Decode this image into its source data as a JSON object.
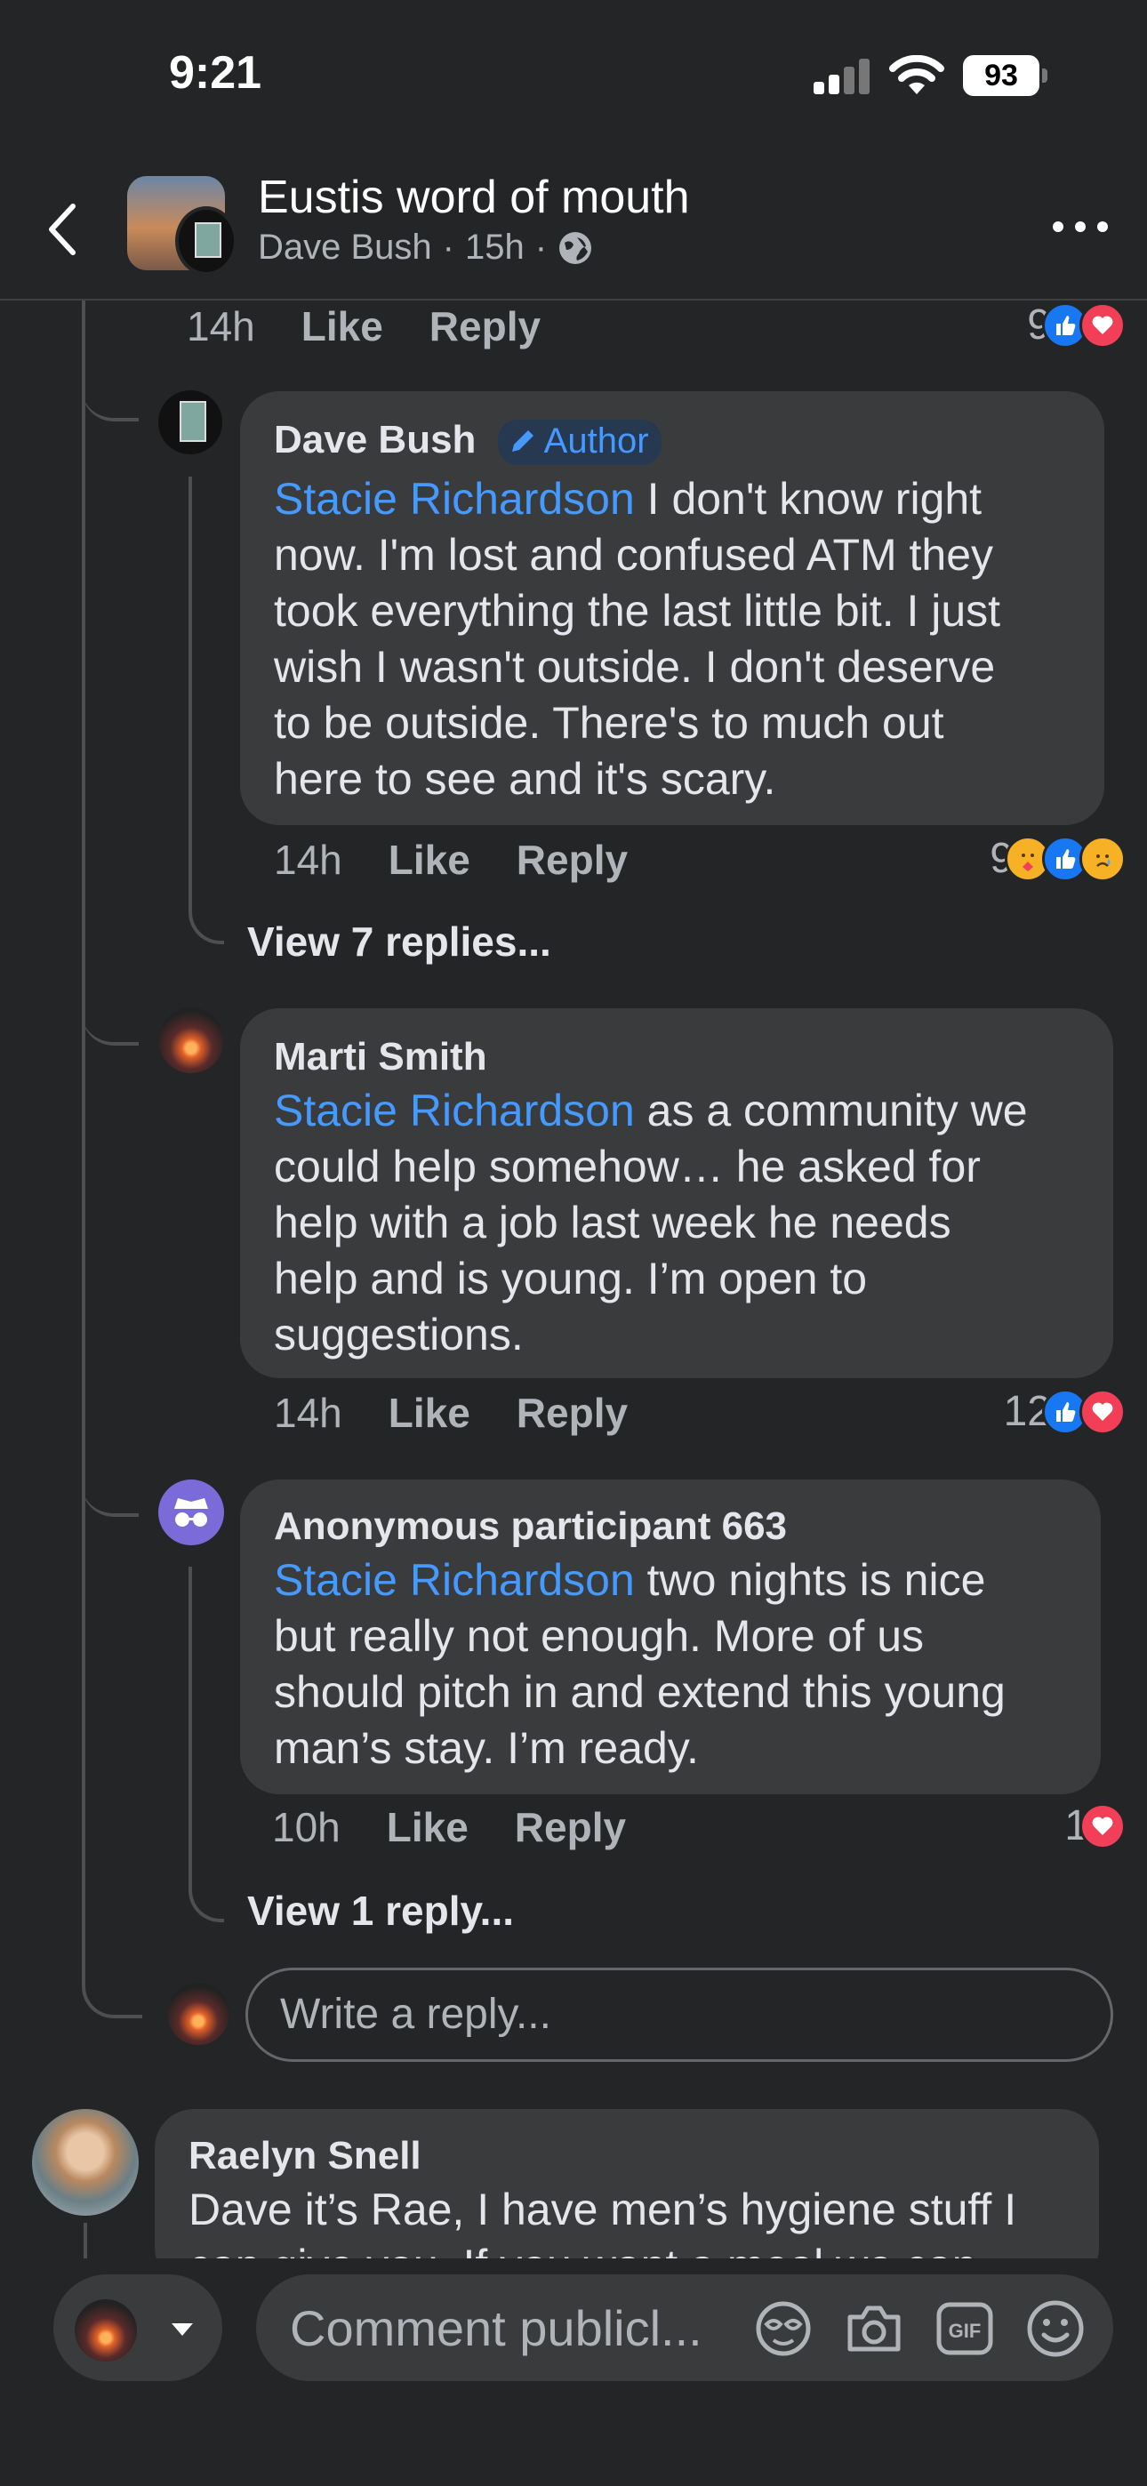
{
  "status_bar": {
    "time": "9:21",
    "battery": "93"
  },
  "header": {
    "title": "Eustis word of mouth",
    "author": "Dave Bush",
    "time": "15h"
  },
  "top_meta": {
    "time": "14h",
    "like": "Like",
    "reply": "Reply",
    "reaction_count": "9"
  },
  "comments": [
    {
      "name": "Dave Bush",
      "badge": "Author",
      "mention": "Stacie Richardson",
      "line1_rest": " I don't know right",
      "lines": [
        "now. I'm lost and confused ATM they",
        "took everything the last little bit. I just",
        "wish I wasn't outside. I don't deserve",
        "to be outside. There's to much out",
        "here to see and it's scary."
      ],
      "time": "14h",
      "like": "Like",
      "reply": "Reply",
      "reaction_count": "9",
      "view_replies": "View 7 replies..."
    },
    {
      "name": "Marti Smith",
      "mention": "Stacie Richardson",
      "line1_rest": " as a community we",
      "lines": [
        "could help somehow… he asked for",
        "help with a job last week he needs",
        "help and is young. I’m open to",
        "suggestions."
      ],
      "time": "14h",
      "like": "Like",
      "reply": "Reply",
      "reaction_count": "12"
    },
    {
      "name": "Anonymous participant 663",
      "mention": "Stacie Richardson",
      "line1_rest": " two nights is nice",
      "lines": [
        "but really not enough. More of us",
        "should pitch in and extend this young",
        "man’s stay. I’m ready."
      ],
      "time": "10h",
      "like": "Like",
      "reply": "Reply",
      "reaction_count": "1",
      "view_replies": "View 1 reply..."
    }
  ],
  "reply_field": {
    "placeholder": "Write a reply..."
  },
  "raelyn": {
    "name": "Raelyn Snell",
    "line1": "Dave it’s Rae, I have men’s hygiene stuff I",
    "line2": "can give you. If you want a meal we can"
  },
  "composer": {
    "placeholder": "Comment publicl..."
  },
  "colors": {
    "background": "#242526",
    "bubble": "#3a3b3c",
    "mention": "#4599ff",
    "like": "#1877f2",
    "love": "#f33e58"
  }
}
